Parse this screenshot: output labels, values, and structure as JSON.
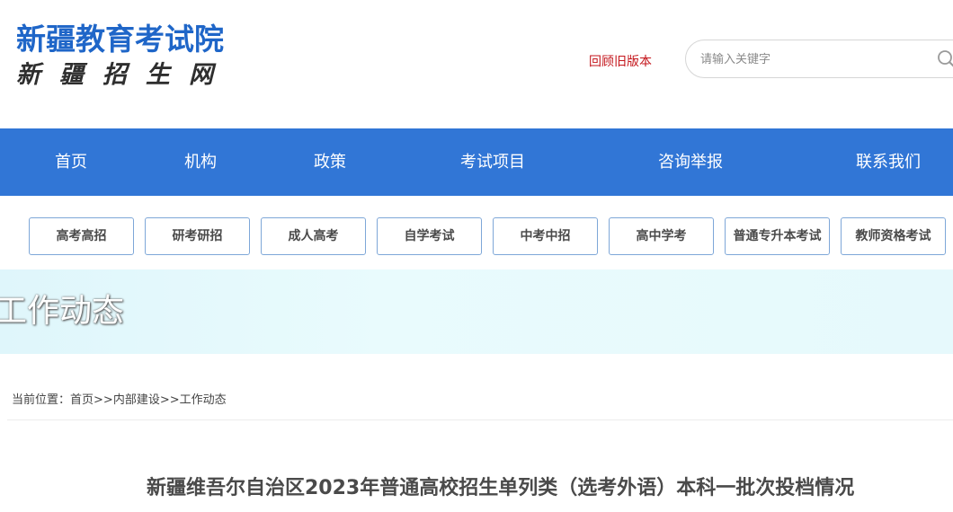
{
  "header": {
    "logo_main": "新疆教育考试院",
    "logo_sub": "新疆招生网",
    "old_version_link": "回顾旧版本",
    "search": {
      "placeholder": "请输入关键字",
      "value": ""
    }
  },
  "nav": {
    "items": [
      {
        "label": "首页"
      },
      {
        "label": "机构"
      },
      {
        "label": "政策"
      },
      {
        "label": "考试项目"
      },
      {
        "label": "咨询举报"
      },
      {
        "label": "联系我们"
      }
    ]
  },
  "categories": [
    {
      "label": "高考高招"
    },
    {
      "label": "研考研招"
    },
    {
      "label": "成人高考"
    },
    {
      "label": "自学考试"
    },
    {
      "label": "中考中招"
    },
    {
      "label": "高中学考"
    },
    {
      "label": "普通专升本考试"
    },
    {
      "label": "教师资格考试"
    }
  ],
  "banner": {
    "title": "工作动态"
  },
  "breadcrumb": {
    "prefix": "当前位置：",
    "items": [
      {
        "label": "首页"
      },
      {
        "label": "内部建设"
      },
      {
        "label": "工作动态"
      }
    ],
    "separator": ">>"
  },
  "article": {
    "title": "新疆维吾尔自治区2023年普通高校招生单列类（选考外语）本科一批次投档情况"
  },
  "colors": {
    "brand_blue": "#1f66c8",
    "nav_blue": "#3176d6",
    "link_red": "#c4161c"
  }
}
